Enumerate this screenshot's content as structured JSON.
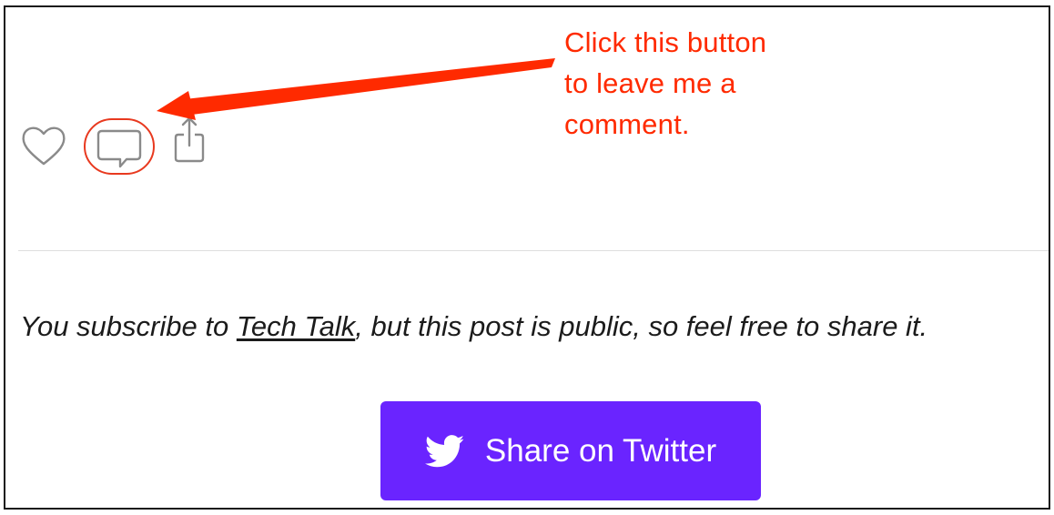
{
  "post_actions": {
    "like": {
      "icon": "heart-icon"
    },
    "comment": {
      "icon": "comment-bubble-icon",
      "highlighted": true,
      "highlight_color": "#e8391f"
    },
    "share": {
      "icon": "share-icon"
    }
  },
  "annotation": {
    "lines": [
      "Click this button",
      "to leave me a",
      "comment."
    ],
    "color": "#ff2a00"
  },
  "subscription_notice": {
    "before": "You subscribe to ",
    "publication_link": "Tech Talk",
    "after": ", but this post is public, so feel free to share it."
  },
  "share_twitter_button": {
    "label": "Share on Twitter",
    "icon": "twitter-bird-icon",
    "background": "#6a24ff"
  },
  "colors": {
    "icon_gray": "#8a8a8a",
    "divider": "#dedede",
    "text": "#1b1b1b"
  }
}
